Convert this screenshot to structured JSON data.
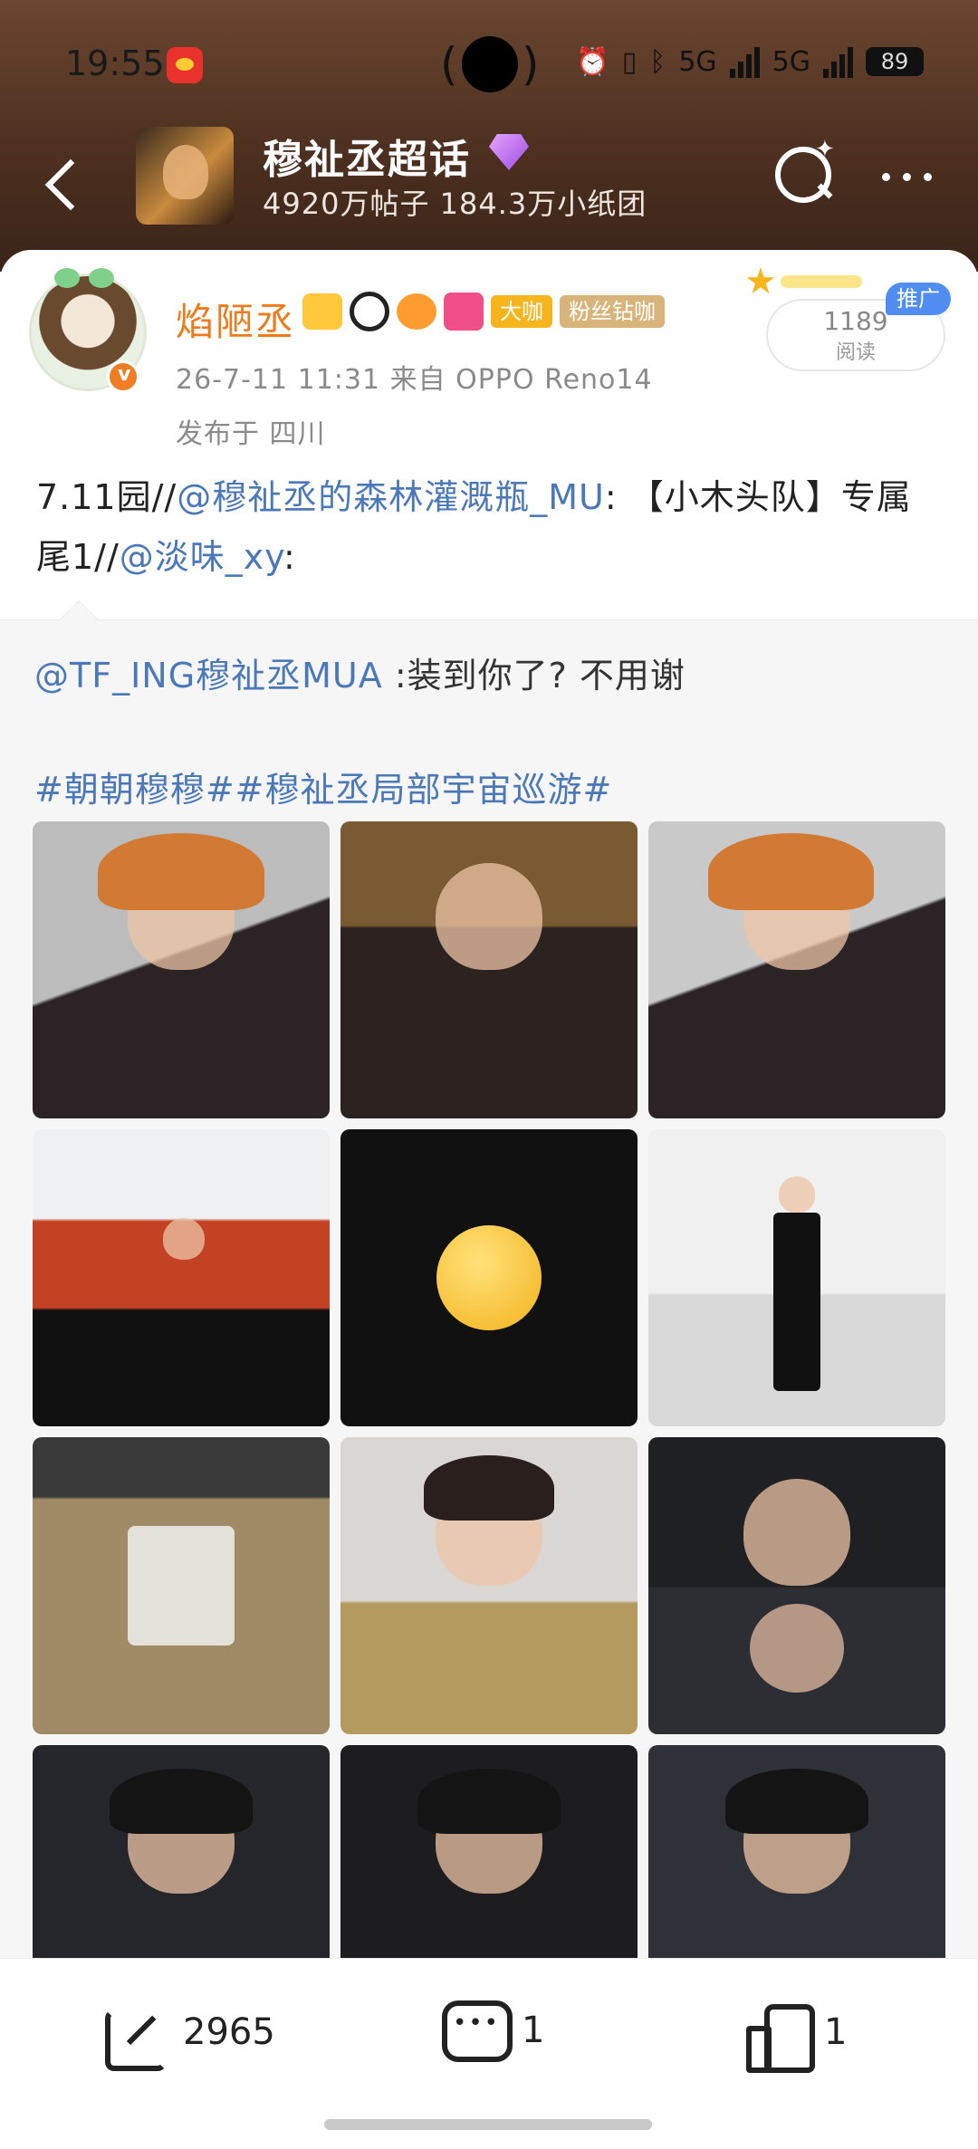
{
  "status_bar": {
    "time": "19:55",
    "network_1": "5G",
    "network_2": "5G",
    "battery": "89"
  },
  "header": {
    "title": "穆祉丞超话",
    "stats": "4920万帖子 184.3万小纸团"
  },
  "post": {
    "username": "焰陋丞",
    "tag_1": "大咖",
    "tag_2": "粉丝钻咖",
    "meta": "26-7-11 11:31  来自 OPPO Reno14",
    "location": "发布于 四川",
    "read_count": "1189",
    "read_label": "阅读",
    "promo": "推广",
    "text_prefix": "7.11园//",
    "text_mention_1": "@穆祉丞的森林灌溉瓶_MU",
    "text_middle": ": 【小木头队】专属尾1//",
    "text_mention_2": "@淡味_xy",
    "text_suffix": ":"
  },
  "repost": {
    "mention": "@TF_ING穆祉丞MUA",
    "text": " :装到你了? 不用谢",
    "hashtags": "#朝朝穆穆##穆祉丞局部宇宙巡游#"
  },
  "actions": {
    "share_count": "2965",
    "comment_count": "1",
    "like_count": "1"
  }
}
